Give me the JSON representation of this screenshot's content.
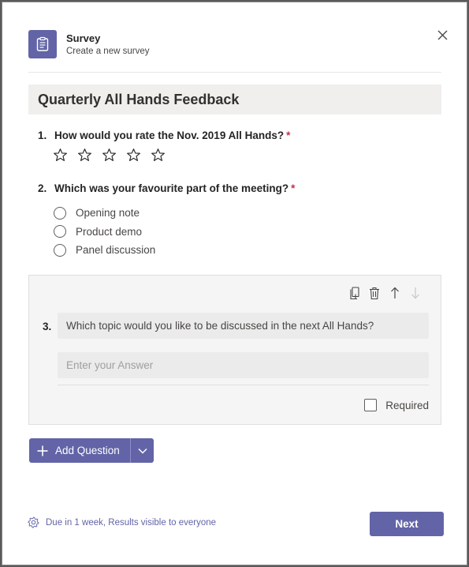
{
  "header": {
    "app_title": "Survey",
    "app_subtitle": "Create a new survey"
  },
  "survey": {
    "title": "Quarterly All Hands Feedback"
  },
  "questions": [
    {
      "number": "1.",
      "text": "How would you rate the Nov. 2019 All Hands?",
      "required_mark": "*",
      "type": "rating",
      "stars": 5
    },
    {
      "number": "2.",
      "text": "Which was your favourite part of the meeting?",
      "required_mark": "*",
      "type": "choice",
      "options": [
        "Opening note",
        "Product demo",
        "Panel discussion"
      ]
    }
  ],
  "editing_question": {
    "number": "3.",
    "text": "Which topic would you like to be discussed in the next All Hands?",
    "answer_placeholder": "Enter your Answer",
    "required_label": "Required",
    "required_checked": false
  },
  "toolbar": {
    "add_question_label": "Add Question"
  },
  "footer": {
    "settings_text": "Due in 1 week, Results visible to everyone",
    "next_label": "Next"
  },
  "icons": {
    "app": "survey-clipboard-icon",
    "close": "close-icon",
    "duplicate": "duplicate-icon",
    "delete": "trash-icon",
    "move_up": "arrow-up-icon",
    "move_down": "arrow-down-icon",
    "add": "plus-icon",
    "dropdown": "chevron-down-icon",
    "settings": "gear-icon",
    "rating": "star-icon"
  },
  "colors": {
    "accent": "#6264a7",
    "required": "#c4314b"
  }
}
